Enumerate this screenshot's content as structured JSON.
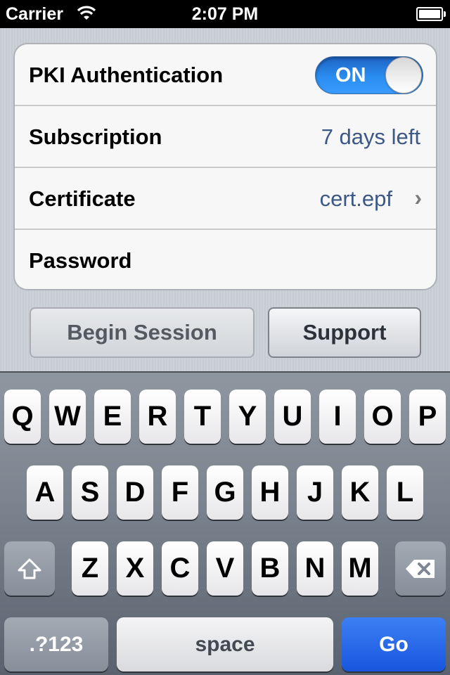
{
  "status_bar": {
    "carrier": "Carrier",
    "time": "2:07 PM",
    "icons": [
      "wifi-icon",
      "battery-icon"
    ]
  },
  "settings": {
    "pki": {
      "label": "PKI Authentication",
      "toggle_label": "ON",
      "enabled": true
    },
    "subscription": {
      "label": "Subscription",
      "value": "7 days left"
    },
    "certificate": {
      "label": "Certificate",
      "value": "cert.epf",
      "chevron": "›"
    },
    "password": {
      "label": "Password",
      "value": ""
    }
  },
  "buttons": {
    "begin_session": "Begin Session",
    "support": "Support"
  },
  "keyboard": {
    "row1": [
      "Q",
      "W",
      "E",
      "R",
      "T",
      "Y",
      "U",
      "I",
      "O",
      "P"
    ],
    "row2": [
      "A",
      "S",
      "D",
      "F",
      "G",
      "H",
      "J",
      "K",
      "L"
    ],
    "row3": [
      "Z",
      "X",
      "C",
      "V",
      "B",
      "N",
      "M"
    ],
    "numbers_label": ".?123",
    "space_label": "space",
    "go_label": "Go",
    "icons": [
      "shift-icon",
      "backspace-icon"
    ]
  },
  "colors": {
    "accent_blue": "#2a8df0",
    "value_text": "#3c5886",
    "go_key": "#1856de"
  }
}
